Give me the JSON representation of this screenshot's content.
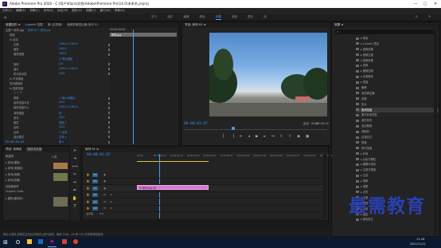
{
  "titlebar": {
    "app_abbr": "Pr",
    "title": "Adobe Premiere Pro 2020 - C:\\用户\\Klara\\文档\\Adobe\\Premiere Pro\\14.0\\未命名.prproj",
    "min": "—",
    "max": "▢",
    "close": "✕"
  },
  "menu": [
    "文件(F)",
    "编辑(E)",
    "剪辑(C)",
    "序列(S)",
    "标记(M)",
    "图形(G)",
    "视图(V)",
    "窗口(W)",
    "帮助(H)"
  ],
  "workspaces": {
    "items": [
      "学习",
      "组件",
      "编辑",
      "颜色",
      "效果",
      "音频",
      "图形",
      "库"
    ],
    "active": 4
  },
  "effect_controls": {
    "tabs": [
      "效果控件 ≡",
      "Lumetri 范围",
      "源:(无剪辑)",
      "音频剪辑混合器:序列 01"
    ],
    "master": "主要 * 序列.jpg",
    "seq": "序列 01 * 序列.jpg",
    "clip_label": "序列.jpg",
    "timecode": "00:00:00:00",
    "rows": [
      {
        "label": "视频",
        "indent": 1,
        "val": ""
      },
      {
        "label": "fx 运动",
        "indent": 1,
        "val": ""
      },
      {
        "label": "位置",
        "indent": 2,
        "val": "2284.0    1364.0"
      },
      {
        "label": "缩放",
        "indent": 2,
        "val": "100.0"
      },
      {
        "label": "缩放宽度",
        "indent": 2,
        "val": "100.0"
      },
      {
        "label": "",
        "indent": 3,
        "val": "☑ 等比缩放"
      },
      {
        "label": "旋转",
        "indent": 2,
        "val": "0.0"
      },
      {
        "label": "锚点",
        "indent": 2,
        "val": "2284.0    1364.0"
      },
      {
        "label": "防闪烁滤镜",
        "indent": 2,
        "val": "0.00"
      },
      {
        "label": "fx 不透明度",
        "indent": 1,
        "val": ""
      },
      {
        "label": "时间重映射",
        "indent": 1,
        "val": ""
      },
      {
        "label": "fx 旋转扭曲",
        "indent": 1,
        "val": ""
      },
      {
        "label": "○ □ ✎",
        "indent": 2,
        "val": ""
      },
      {
        "label": "角度",
        "indent": 2,
        "val": "☐ 最大化输出"
      },
      {
        "label": "旋转扭曲半径",
        "indent": 2,
        "val": "50.0"
      },
      {
        "label": "旋转扭曲中心",
        "indent": 2,
        "val": "2284.0 1364.0"
      },
      {
        "label": "消除锯齿",
        "indent": 2,
        "val": "低"
      },
      {
        "label": "锐化",
        "indent": 2,
        "val": "10.0"
      },
      {
        "label": "图层",
        "indent": 2,
        "val": "视频 1"
      },
      {
        "label": "反转",
        "indent": 2,
        "val": "10.0"
      },
      {
        "label": "合成",
        "indent": 2,
        "val": "☐ 反转"
      },
      {
        "label": "混合模式",
        "indent": 2,
        "val": "正常 ▾"
      },
      {
        "label": "",
        "indent": 2,
        "val": "源 ▾"
      }
    ]
  },
  "program": {
    "title": "节目: 序列 01 ≡",
    "tc_in": "00:00:01:07",
    "tc_out": "00:00:04:02",
    "zoom": "适合",
    "quality": "完整",
    "fraction": "1/2"
  },
  "project": {
    "title": "项目: 未命名",
    "tab2": "媒体浏览器",
    "count": "4 项",
    "items": [
      "序列 01",
      "序列.jpg",
      "Graphic",
      "序列.mp4"
    ],
    "tree": [
      "新建项",
      "▸ 序列(模拟)",
      "▸ 序列(未使用)",
      "▸ 序列(剪辑)",
      "▸ 序列(剪辑)",
      "扫描原素材",
      "Graphic Links",
      "▸ 图形(媒体库)"
    ]
  },
  "timeline": {
    "title": "序列 01 ≡",
    "timecode": "00:00:01:07",
    "ruler": [
      "00:00",
      "00:00:01:00",
      "00:00:02:00",
      "00:00:03:00",
      "00:00:04:00",
      "00:00:05:00",
      "00:00:06:00",
      "00:00:07:00",
      "00:00:08:00",
      "00:00:09:00",
      "00:00:10:00",
      "00:00:11:00"
    ],
    "tracks": [
      "V3",
      "V2",
      "V1",
      "A1",
      "A2",
      "A3"
    ],
    "clip_label": "fx 序列.jpg [V]",
    "master": "主声道",
    "master_val": "0.0"
  },
  "effects_panel": {
    "title": "效果 ≡",
    "search_placeholder": "",
    "tree": [
      {
        "label": "▸ 预设",
        "sel": false
      },
      {
        "label": "▸ Lumetri 预设",
        "sel": false
      },
      {
        "label": "▸ 音频效果",
        "sel": false
      },
      {
        "label": "▸ 音频过渡",
        "sel": false
      },
      {
        "label": "▾ 视频效果",
        "sel": false
      },
      {
        "label": "▸ 变换",
        "sel": false
      },
      {
        "label": "▸ 图像控制",
        "sel": false
      },
      {
        "label": "▸ 实用程序",
        "sel": false
      },
      {
        "label": "▾ 扭曲",
        "sel": false
      },
      {
        "label": "  偏移",
        "sel": false
      },
      {
        "label": "  变形稳定器",
        "sel": false
      },
      {
        "label": "  变换",
        "sel": false
      },
      {
        "label": "  放大",
        "sel": false
      },
      {
        "label": "  旋转扭曲",
        "sel": true
      },
      {
        "label": "  果冻效应修复",
        "sel": false
      },
      {
        "label": "  波形变形",
        "sel": false
      },
      {
        "label": "  湍流置换",
        "sel": false
      },
      {
        "label": "  球面化",
        "sel": false
      },
      {
        "label": "  边角定位",
        "sel": false
      },
      {
        "label": "  镜像",
        "sel": false
      },
      {
        "label": "  镜头扭曲",
        "sel": false
      },
      {
        "label": "▸ 时间",
        "sel": false
      },
      {
        "label": "▸ 杂色与颗粒",
        "sel": false
      },
      {
        "label": "▸ 模糊与锐化",
        "sel": false
      },
      {
        "label": "▸ 沉浸式视频",
        "sel": false
      },
      {
        "label": "▸ 生成",
        "sel": false
      },
      {
        "label": "▸ 视频",
        "sel": false
      },
      {
        "label": "▸ 调整",
        "sel": false
      },
      {
        "label": "▸ 过时",
        "sel": false
      },
      {
        "label": "▸ 过渡",
        "sel": false
      },
      {
        "label": "▸ 透视",
        "sel": false
      },
      {
        "label": "▸ 通道",
        "sel": false
      },
      {
        "label": "▸ 键控",
        "sel": false
      },
      {
        "label": "▸ 颜色校正",
        "sel": false
      }
    ]
  },
  "status": "单击以选择,或单击空白处并拖动以进行选择。使用 Shift、Alt 和 Ctrl 可获得其他选项。",
  "watermark": "最需教育",
  "taskbar": {
    "time": "11:26",
    "date": "2021/11/12"
  }
}
